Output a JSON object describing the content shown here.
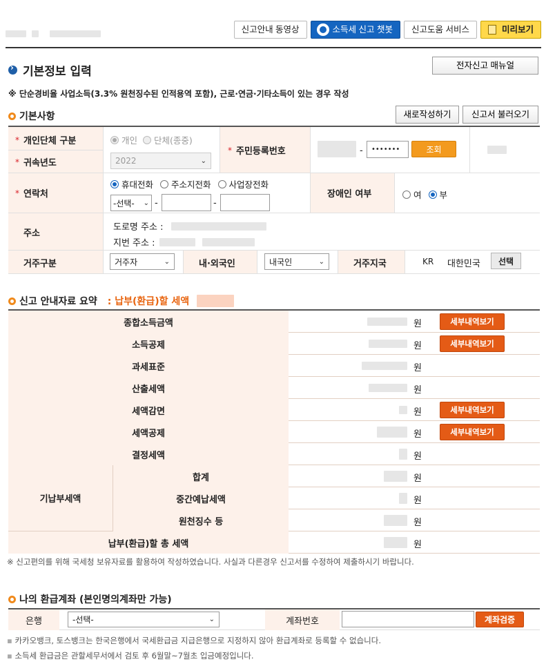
{
  "toolbar": {
    "video_guide": "신고안내 동영상",
    "chatbot": "소득세 신고 챗봇",
    "help_service": "신고도움 서비스",
    "preview": "미리보기"
  },
  "page": {
    "title": "기본정보 입력",
    "manual_button": "전자신고 매뉴얼",
    "notice": "※ 단순경비율 사업소득(3.3% 원천징수된 인적용역 포함), 근로·연금·기타소득이 있는 경우 작성"
  },
  "basic": {
    "title": "기본사항",
    "new_button": "새로작성하기",
    "load_button": "신고서 불러오기",
    "type_label": "개인단체 구분",
    "type_options": [
      "개인",
      "단체(종중)"
    ],
    "year_label": "귀속년도",
    "year_value": "2022",
    "ssn_label": "주민등록번호",
    "ssn_dash": "-",
    "ssn_back": "•••••••",
    "lookup_button": "조회",
    "contact_label": "연락처",
    "contact_options": [
      "휴대전화",
      "주소지전화",
      "사업장전화"
    ],
    "phone_select": "-선택-",
    "phone_dash": "-",
    "disability_label": "장애인 여부",
    "disability_options": [
      "여",
      "부"
    ],
    "address_label": "주소",
    "road_address": "도로명 주소 :",
    "lot_address": "지번 주소 :",
    "residence_label": "거주구분",
    "residence_value": "거주자",
    "nationality_label": "내·외국인",
    "nationality_value": "내국인",
    "country_label": "거주지국",
    "country_code": "KR",
    "country_name": "대한민국",
    "select_button": "선택"
  },
  "summary": {
    "title": "신고 안내자료 요약",
    "pay_label": ": 납부(환급)할 세액",
    "won": "원",
    "detail_button": "세부내역보기",
    "rows": [
      "종합소득금액",
      "소득공제",
      "과세표준",
      "산출세액",
      "세액감면",
      "세액공제",
      "결정세액"
    ],
    "prepaid_label": "기납부세액",
    "prepaid_rows": [
      "합계",
      "중간예납세액",
      "원천징수 등"
    ],
    "total_label": "납부(환급)할 총 세액",
    "footnote": "※ 신고편의를 위해 국세청 보유자료를 활용하여 작성하였습니다. 사실과 다른경우 신고서를 수정하여 제출하시기 바랍니다."
  },
  "refund": {
    "title": "나의 환급계좌 (본인명의계좌만 가능)",
    "bank_label": "은행",
    "bank_select": "-선택-",
    "account_label": "계좌번호",
    "verify_button": "계좌검증",
    "note1": "카카오뱅크, 토스뱅크는 한국은행에서 국세환급금 지급은행으로 지정하지 않아 환급계좌로 등록할 수 없습니다.",
    "note2": "소득세 환급금은 관할세무서에서 검토 후 6월말~7월초 입금예정입니다."
  }
}
